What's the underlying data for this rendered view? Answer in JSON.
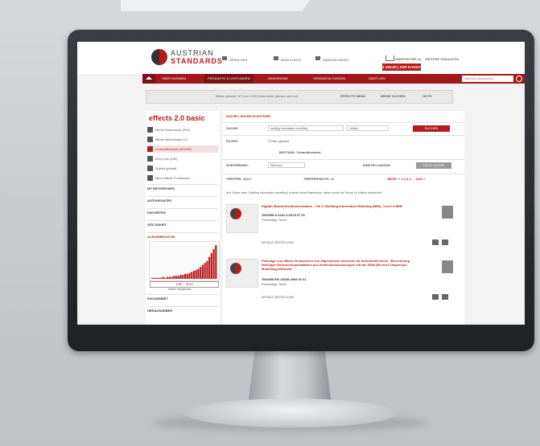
{
  "header": {
    "logo_line1": "AUSTRIAN",
    "logo_line2": "STANDARDS",
    "links": [
      "SPRACHEN",
      "MEIN KONTO",
      "ANWENDUNGEN"
    ],
    "cart": "WARENKORB (4)",
    "price": "€ 420,00 | ZUR KASSA",
    "more": "WEITERE EINKAUFEN"
  },
  "nav": {
    "items": [
      "ÜBER NORMEN",
      "PRODUKTE & LEISTUNGEN",
      "NEWSROOM",
      "VERANSTALTUNGEN",
      "ÜBER UNS"
    ],
    "search_placeholder": "Webshop durchsuchen"
  },
  "strip": {
    "text": "Bisher genutzt: 57 von 1.200 Dokumente (dieses und vor)",
    "menu": "EFFECTS MENÜ",
    "my_search": "MEINE SUCHEN",
    "help": "HILFE"
  },
  "sidebar": {
    "title": "effects 2.0 basic",
    "items": [
      "Meine Dokumente (292)",
      "Meine Neuerungen (7)",
      "Gesamtbestand (301057)",
      "docs plus (232)",
      "Zuletzt gekauft",
      "Mehr effects Funktionen"
    ],
    "sections": [
      "MY INFOGROUPS",
      "AUTOUPDATES",
      "FAVORITEN",
      "GÜLTIGKEIT",
      "AUSGABEDATUM",
      "FACHGEBIET",
      "HERAUSGEBER"
    ],
    "range": "1987 - 2016",
    "range_caption": "Datum eingrenzen",
    "hist_values": [
      1,
      1,
      1,
      1,
      1,
      2,
      1,
      2,
      2,
      2,
      3,
      3,
      3,
      4,
      4,
      5,
      5,
      6,
      7,
      8,
      9,
      10,
      12,
      14,
      16,
      18,
      22,
      26,
      30,
      34
    ]
  },
  "main": {
    "breadcrumb": "SUCHE | SUCHE IN NOTIZEN",
    "search_label": "SUCHE:",
    "search_value": "building information modelling",
    "search_scope": "Volltext",
    "search_button": "SUCHEN",
    "filter_label": "FILTER:",
    "filter_value": "0 Filter gesetzt",
    "bestand": "BESTAND: Gesamtbestand",
    "sort_label": "SORTIERUNG:",
    "sort_value": "Relevanz",
    "settings": "EINSTELLUNGEN",
    "new_search": "NEUE SUCHE",
    "hits": "TREFFER: 10217",
    "per_page": "TREFFER/SEITE: 10",
    "pages": "SEITE: « 1 2 3 4 ... 1022 »",
    "notice": "Ihre Suche nach \"building information modelling\" brachte keine Ergebnisse, daher wurde die Suche im Volltext wiederholt.",
    "results": [
      {
        "title": "Digitale Bauwerksdokumentation - Teil 2: Building Information Modeling (BIM) - Level 3-iBIM",
        "norm": "ÖNORM A 6241-2:2015 07 01",
        "type": "Produkttyp: Norm",
        "links": "DETAILS | BESTELLUNG"
      },
      {
        "title": "Flüchtige und diffuse Emissionen von allgemeinem Interesse für Industriebereiche - Berechnung flüchtiger Emissionsquellstärken aus Immissionsmessungen mit der RDM (Reverse Dispersion Modelling)-Methode",
        "norm": "ÖNORM EN 15445:2008 01 01",
        "type": "Produkttyp: Norm",
        "links": "DETAILS | BESTELLUNG"
      }
    ]
  }
}
